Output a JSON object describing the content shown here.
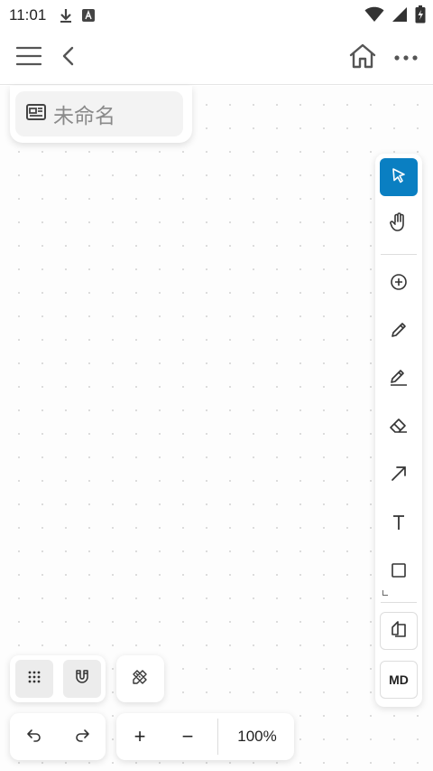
{
  "status_bar": {
    "time": "11:01",
    "icons": [
      "download-icon",
      "font-app-icon",
      "wifi-icon",
      "signal-icon",
      "battery-icon"
    ]
  },
  "app_bar": {
    "icons": [
      "menu-icon",
      "back-icon",
      "home-icon",
      "more-icon"
    ]
  },
  "document": {
    "title_placeholder": "未命名",
    "icon": "board-icon"
  },
  "toolbar": {
    "tools": [
      "select-icon",
      "hand-icon",
      "add-circle-icon",
      "pen-icon",
      "highlighter-icon",
      "eraser-icon",
      "arrow-icon",
      "text-icon",
      "rectangle-icon",
      "shapes-icon"
    ],
    "active_tool": "select",
    "md_label": "MD",
    "accent_color": "#0a7fc2"
  },
  "bottom_controls": {
    "grid_icon": "grid-dots-icon",
    "snap_icon": "magnet-icon",
    "ruler_icon": "ruler-pencil-icon",
    "undo_icon": "undo-icon",
    "redo_icon": "redo-icon",
    "zoom_in": "+",
    "zoom_out": "−",
    "zoom_level": "100%"
  }
}
